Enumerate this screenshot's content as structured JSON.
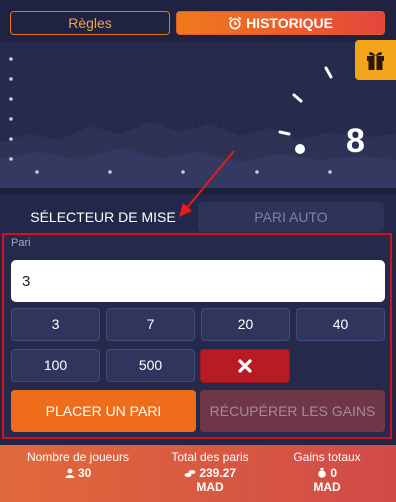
{
  "header": {
    "rules_label": "Règles",
    "history_label": "HISTORIQUE"
  },
  "game": {
    "multiplier": "8"
  },
  "icons": {
    "clock": "alarm-clock-icon",
    "gift": "gift-icon",
    "user": "user-icon",
    "money": "money-stack-icon",
    "bag": "money-bag-icon",
    "close": "close-icon"
  },
  "colors": {
    "accent_orange": "#ef6c1b",
    "danger_red": "#b71c24",
    "highlight_border": "#d4101e"
  },
  "bet": {
    "tabs": {
      "selector": "SÉLECTEUR DE MISE",
      "auto": "PARI AUTO"
    },
    "label": "Pari",
    "value": "3",
    "chips": [
      "3",
      "7",
      "20",
      "40",
      "100",
      "500"
    ],
    "place_label": "PLACER UN PARI",
    "cashout_label": "RÉCUPÉRER LES GAINS"
  },
  "stats": {
    "players": {
      "label": "Nombre de joueurs",
      "value": "30"
    },
    "total": {
      "label": "Total des paris",
      "value": "239.27",
      "unit": "MAD"
    },
    "winnings": {
      "label": "Gains totaux",
      "value": "0",
      "unit": "MAD"
    }
  }
}
